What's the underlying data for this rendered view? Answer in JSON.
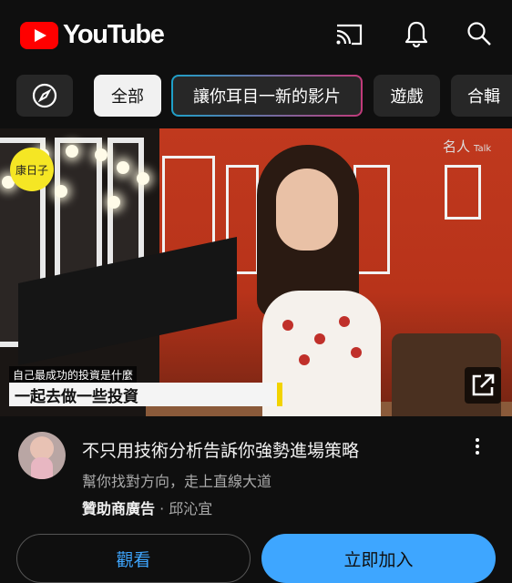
{
  "header": {
    "logo_text": "YouTube",
    "icons": [
      "cast-icon",
      "bell-icon",
      "search-icon"
    ],
    "brand_color": "#ff0000"
  },
  "chips": {
    "explore_icon": "compass-icon",
    "items": [
      {
        "label": "全部",
        "active": true
      },
      {
        "label": "讓你耳目一新的影片",
        "active": false
      },
      {
        "label": "遊戲",
        "active": false
      },
      {
        "label": "合輯",
        "active": false
      }
    ]
  },
  "video": {
    "channel_logo_text": "康日子",
    "brand_mark": "名人",
    "brand_mark_sub": "Talk",
    "caption_small": "自己最成功的投資是什麼",
    "caption_big": "一起去做一些投資",
    "external_link_icon": "open-in-new-icon"
  },
  "ad": {
    "title": "不只用技術分析告訴你強勢進場策略",
    "subtitle": "幫你找對方向，走上直線大道",
    "sponsored_label": "贊助商廣告",
    "separator": "·",
    "channel_name": "邱沁宜",
    "more_icon": "more-vert-icon"
  },
  "actions": {
    "watch_label": "觀看",
    "join_label": "立即加入",
    "accent_color": "#3ea6ff"
  }
}
